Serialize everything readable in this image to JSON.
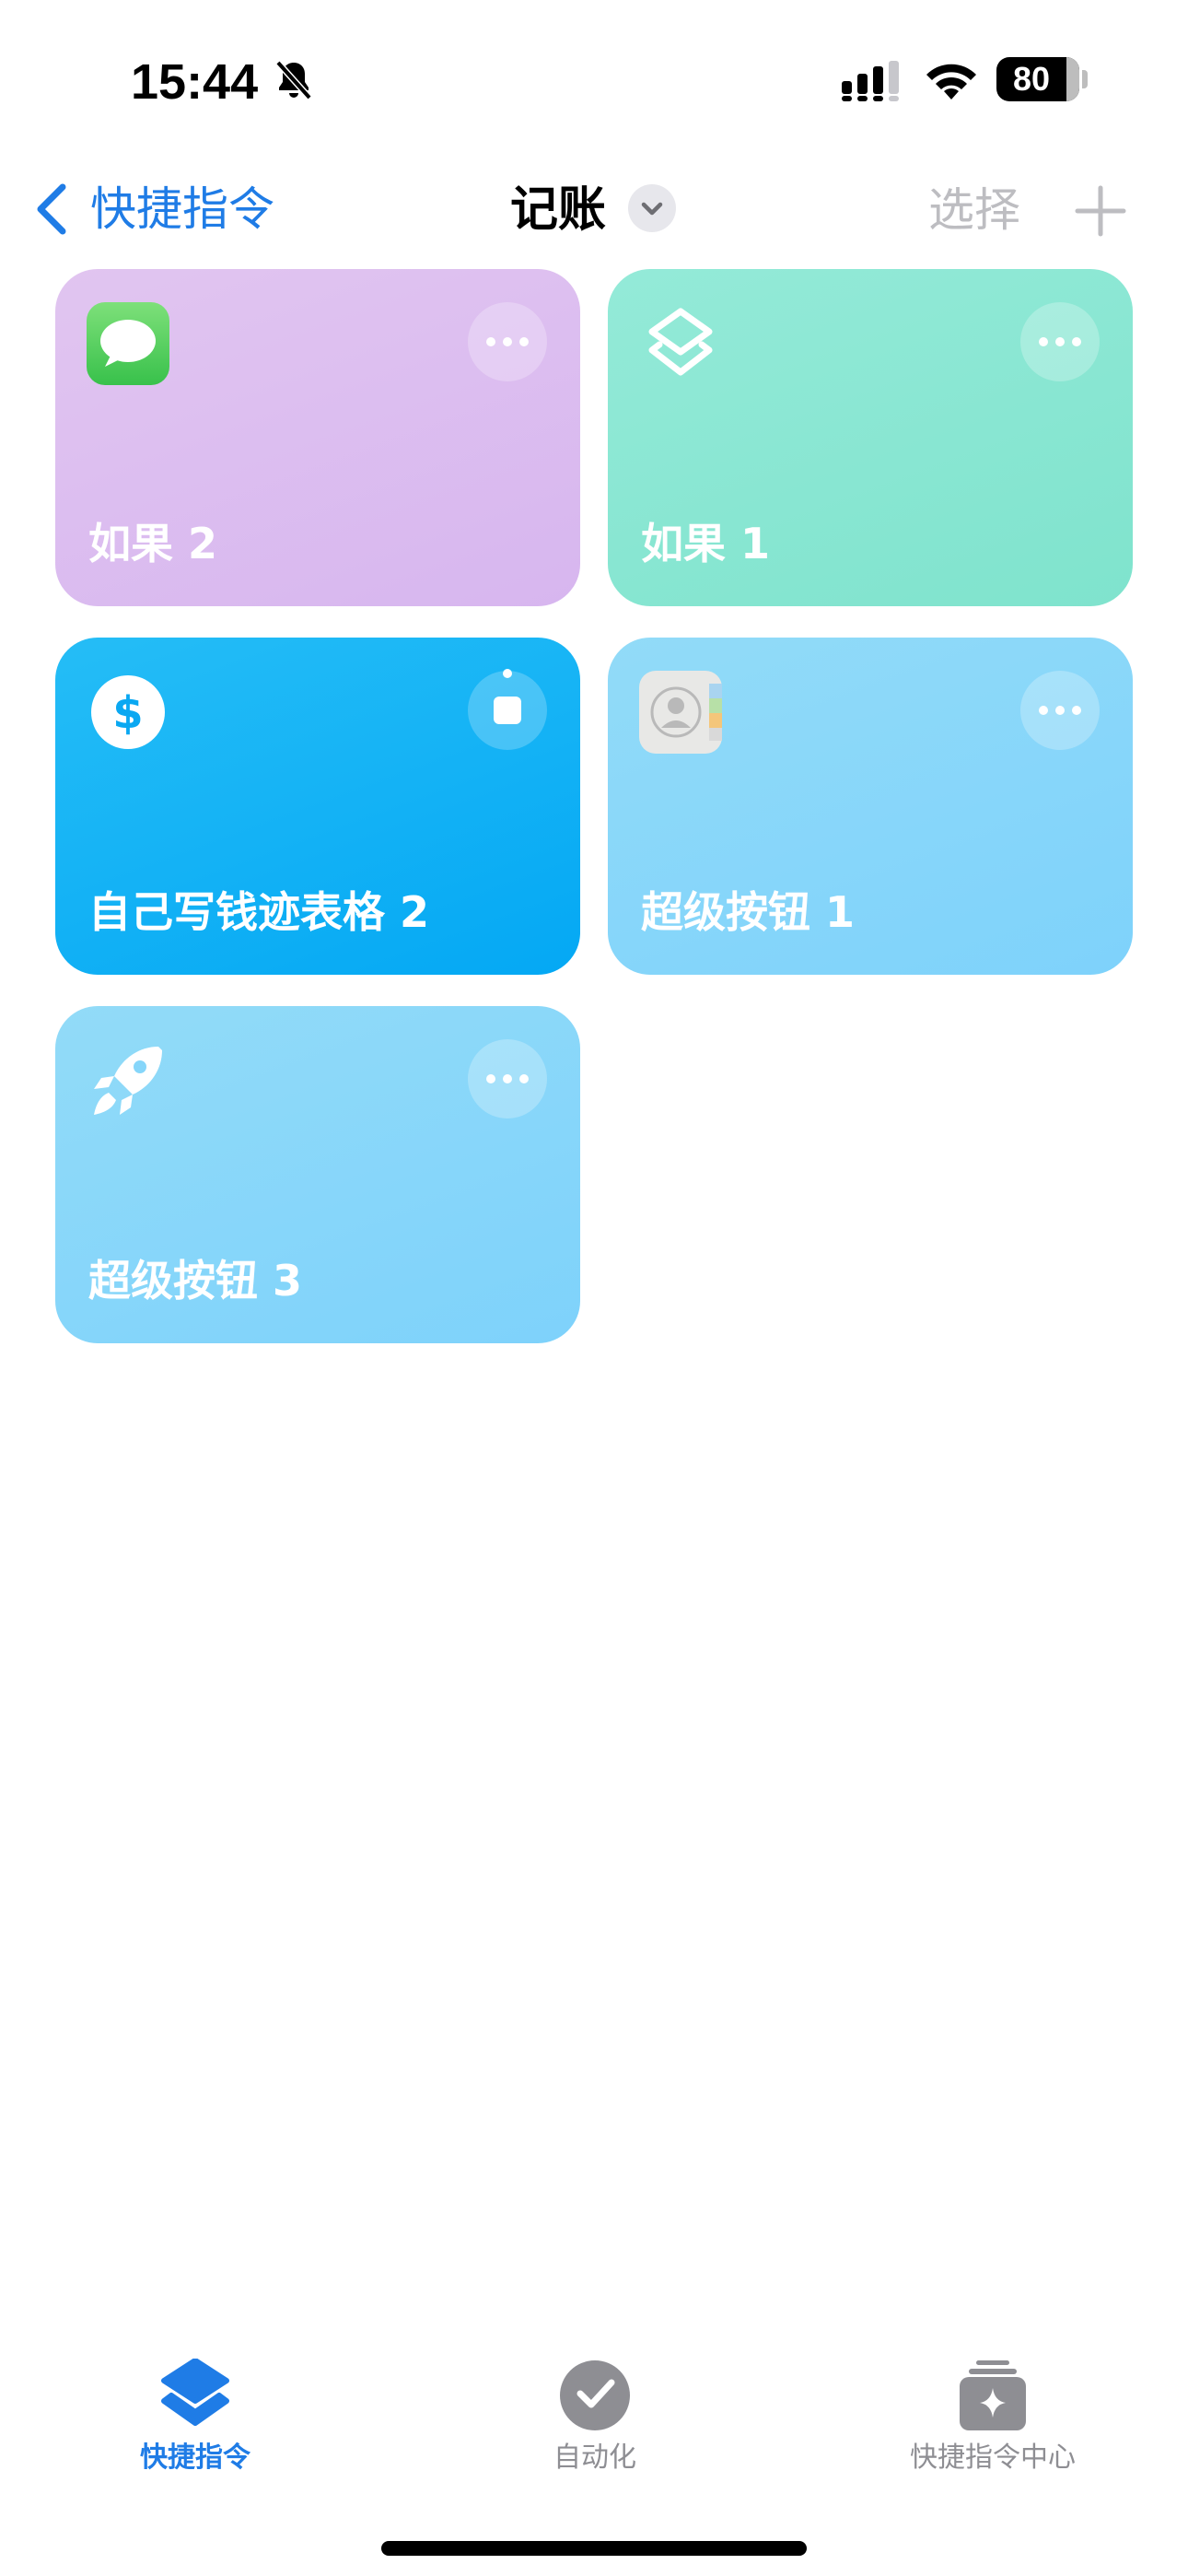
{
  "status_bar": {
    "time": "15:44",
    "battery": "80",
    "icons": [
      "bell-slash-icon",
      "cellular-signal-icon",
      "wifi-icon",
      "battery-icon"
    ]
  },
  "nav": {
    "back_label": "快捷指令",
    "title": "记账",
    "select_label": "选择",
    "icons": [
      "chevron-left-icon",
      "chevron-down-icon",
      "plus-icon"
    ]
  },
  "shortcuts": [
    {
      "label": "如果 2",
      "icon": "messages-app-icon",
      "color": "#dcbcf0",
      "action": "more"
    },
    {
      "label": "如果 1",
      "icon": "layers-icon",
      "color": "#88e7d2",
      "action": "more"
    },
    {
      "label": "自己写钱迹表格 2",
      "icon": "dollar-sign-icon",
      "color": "#0ea9f4",
      "action": "stop"
    },
    {
      "label": "超级按钮 1",
      "icon": "contacts-app-icon",
      "color": "#86d6fa",
      "action": "more"
    },
    {
      "label": "超级按钮 3",
      "icon": "rocket-icon",
      "color": "#86d6fa",
      "action": "more"
    }
  ],
  "tab_bar": {
    "tabs": [
      {
        "label": "快捷指令",
        "icon": "shortcuts-stack-icon",
        "active": true
      },
      {
        "label": "自动化",
        "icon": "automation-check-icon",
        "active": false
      },
      {
        "label": "快捷指令中心",
        "icon": "gallery-sparkle-icon",
        "active": false
      }
    ],
    "accent_color": "#1f7ce6"
  }
}
